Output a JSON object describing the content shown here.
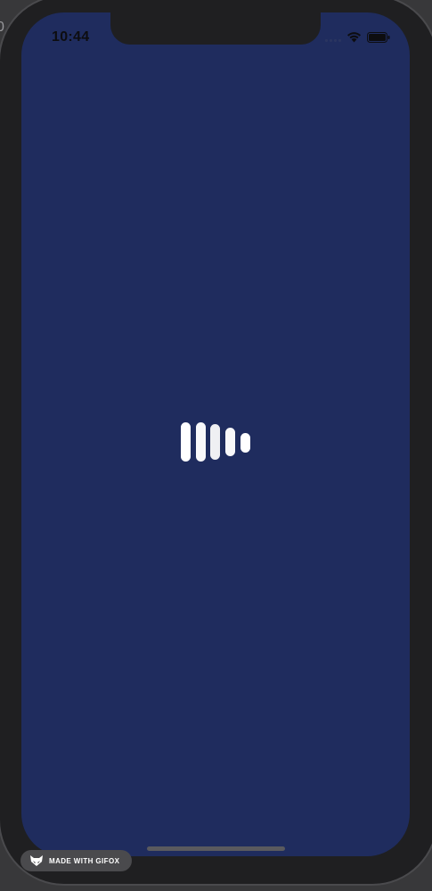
{
  "status_bar": {
    "time": "10:44",
    "signal_icon": "cellular-signal-icon",
    "wifi_icon": "wifi-icon",
    "battery_icon": "battery-icon"
  },
  "background": {
    "screen_color": "#1f2c5e",
    "frame_color": "#1f1f21"
  },
  "loader": {
    "icon": "loading-bars-icon",
    "color": "#ffffff"
  },
  "watermark": {
    "label": "MADE WITH GIFOX",
    "icon": "fox-icon"
  },
  "stray_text": "0"
}
